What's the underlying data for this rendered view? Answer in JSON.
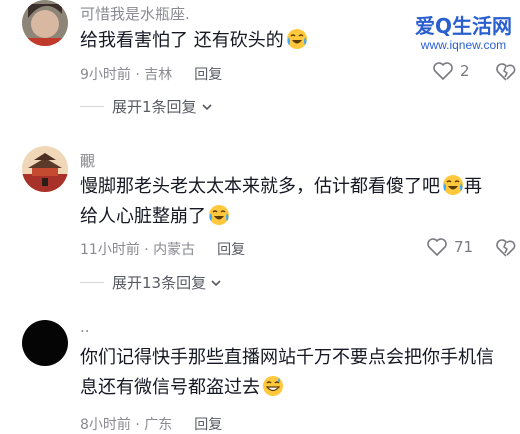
{
  "watermark": {
    "title": "爱Q生活网",
    "url": "www.iqnew.com"
  },
  "comments": [
    {
      "username": "可惜我是水瓶座.",
      "text": "给我看害怕了 还有砍头的",
      "time_location": "9小时前 · 吉林",
      "reply_label": "回复",
      "likes": "2",
      "expand_label": "展开1条回复"
    },
    {
      "username": "覼",
      "text": "慢脚那老头老太太本来就多，估计都看傻了吧",
      "text_line2": "再",
      "text_line3": "给人心脏整崩了",
      "time_location": "11小时前 · 内蒙古",
      "reply_label": "回复",
      "likes": "71",
      "expand_label": "展开13条回复"
    },
    {
      "username": "..",
      "text": "你们记得快手那些直播网站千万不要点会把你手机信息还有微信号都盗过去",
      "time_location": "8小时前 · 广东",
      "reply_label": "回复"
    }
  ],
  "icons": {
    "like": "heart-outline-icon",
    "dislike": "broken-heart-icon",
    "expand": "chevron-down-icon",
    "emoji_cry": "laughing-crying-emoji",
    "emoji_grin": "grinning-sweat-emoji"
  }
}
